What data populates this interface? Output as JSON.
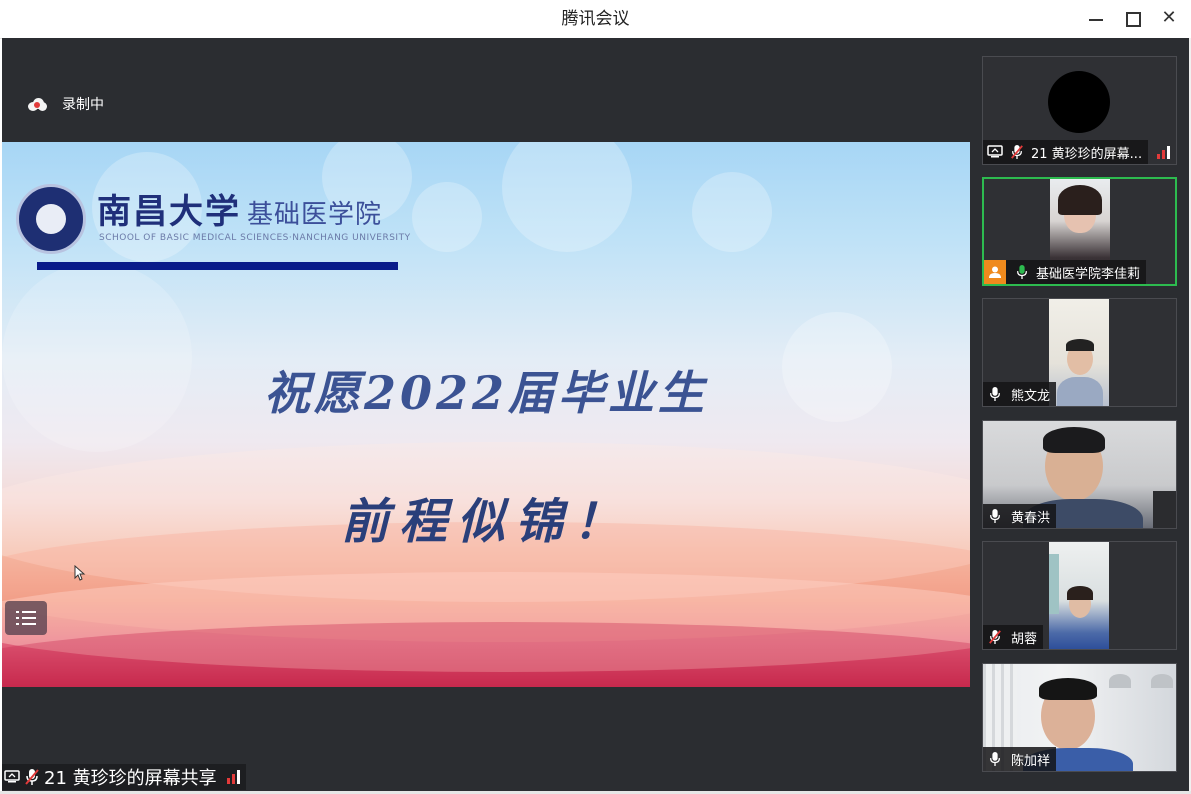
{
  "window": {
    "title": "腾讯会议"
  },
  "recording": {
    "label": "录制中"
  },
  "slide": {
    "university": "南昌大学",
    "department": "基础医学院",
    "subtitle": "SCHOOL OF BASIC MEDICAL SCIENCES·NANCHANG UNIVERSITY",
    "line1": "祝愿2022届毕业生",
    "line2": "前程似锦！"
  },
  "share_label": "21 黄珍珍的屏幕共享",
  "participants": [
    {
      "name": "21 黄珍珍的屏幕...",
      "mic": "muted",
      "sharing": true,
      "video": "avatar"
    },
    {
      "name": "基础医学院李佳莉",
      "mic": "speaking",
      "host": true,
      "active": true,
      "video": "camera"
    },
    {
      "name": "熊文龙",
      "mic": "on",
      "video": "camera"
    },
    {
      "name": "黄春洪",
      "mic": "on",
      "video": "camera"
    },
    {
      "name": "胡蓉",
      "mic": "muted",
      "video": "camera"
    },
    {
      "name": "陈加祥",
      "mic": "on",
      "video": "camera"
    }
  ],
  "colors": {
    "accent_green": "#2dbb4f",
    "muted_red": "#e23a3a",
    "host_orange": "#ef8a1d",
    "background": "#2b2d31"
  }
}
